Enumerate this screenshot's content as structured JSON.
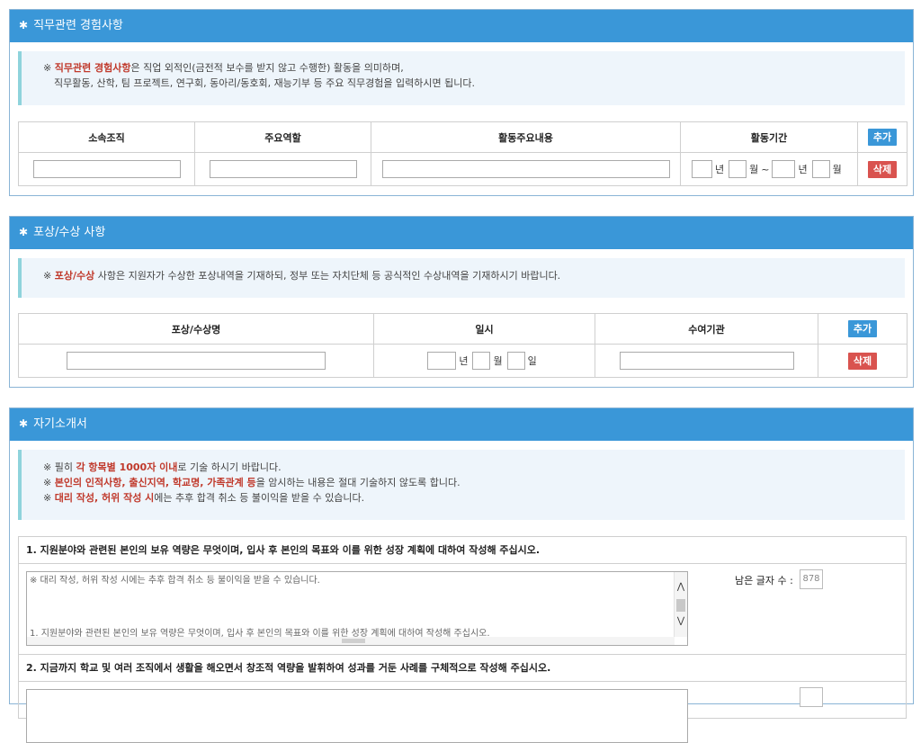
{
  "sections": {
    "experience": {
      "title": "직무관련 경험사항",
      "notice": {
        "prefix": "※ ",
        "highlight": "직무관련 경험사항",
        "line1_rest": "은 직업 외적인(금전적 보수를 받지 않고 수행한) 활동을 의미하며,",
        "line2": "직무활동, 산학, 팀 프로젝트, 연구회, 동아리/동호회, 재능기부 등 주요 직무경험을 입력하시면 됩니다."
      },
      "columns": [
        "소속조직",
        "주요역할",
        "활동주요내용",
        "활동기간"
      ],
      "period_labels": {
        "year": "년",
        "month": "월",
        "tilde": "~"
      },
      "add_label": "추가",
      "delete_label": "삭제"
    },
    "awards": {
      "title": "포상/수상 사항",
      "notice": {
        "prefix": "※ ",
        "highlight": "포상/수상",
        "rest": " 사항은 지원자가 수상한 포상내역을 기재하되, 정부 또는 자치단체 등 공식적인 수상내역을 기재하시기 바랍니다."
      },
      "columns": [
        "포상/수상명",
        "일시",
        "수여기관"
      ],
      "date_labels": {
        "year": "년",
        "month": "월",
        "day": "일"
      },
      "add_label": "추가",
      "delete_label": "삭제"
    },
    "intro": {
      "title": "자기소개서",
      "notice": {
        "l1_a": "※ 필히 ",
        "l1_red": "각 항목별 1000자 이내",
        "l1_b": "로 기술 하시기 바랍니다.",
        "l2_a": "※ ",
        "l2_red": "본인의 인적사항, 출신지역, 학교명, 가족관계 등",
        "l2_b": "을 암시하는 내용은 절대 기술하지 않도록 합니다.",
        "l3_a": "※ ",
        "l3_red": "대리 작성, 허위 작성 시",
        "l3_b": "에는 추후 합격 취소 등 불이익을 받을 수 있습니다."
      },
      "questions": [
        {
          "title": "1. 지원분야와 관련된 본인의 보유 역량은 무엇이며, 입사 후 본인의 목표와 이를 위한 성장 계획에 대하여 작성해 주십시오.",
          "text_line1": "※ 대리 작성, 허위 작성 시에는 추후 합격 취소 등 불이익을 받을 수 있습니다.",
          "text_line2": "1. 지원분야와 관련된 본인의 보유 역량은 무엇이며, 입사 후 본인의 목표와 이를 위한 성장 계획에 대하여 작성해 주십시오.",
          "counter_label": "남은 글자 수 :",
          "counter_value": "878"
        },
        {
          "title": "2. 지금까지 학교 및 여러 조직에서 생활을 해오면서 창조적 역량을 발휘하여 성과를 거둔 사례를 구체적으로 작성해 주십시오."
        }
      ]
    }
  },
  "colors": {
    "header": "#3a97d8",
    "add": "#3a97d8",
    "delete": "#d9534f",
    "highlight": "#c0392b"
  }
}
